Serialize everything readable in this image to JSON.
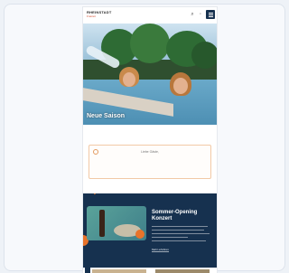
{
  "header": {
    "logo_line1": "RHEINSTADT",
    "logo_line2": "Freizeit",
    "icons": [
      "search-icon",
      "user-icon",
      "menu-icon"
    ]
  },
  "hero": {
    "title": "Neue Saison"
  },
  "notice": {
    "heading": "Liebe Gäste,",
    "lines": [
      "",
      "",
      ""
    ]
  },
  "event": {
    "tag": "",
    "title": "Sommer-Opening Konzert",
    "link_label": "Mehr erfahren"
  },
  "colors": {
    "brand_navy": "#16314f",
    "accent_orange": "#e8732a",
    "notice_border": "#f2c9a6"
  }
}
